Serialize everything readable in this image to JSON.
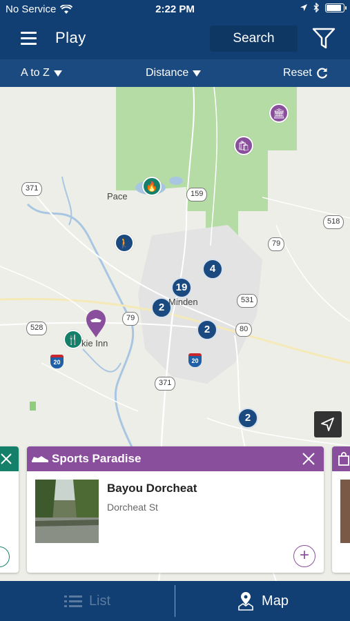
{
  "status_bar": {
    "carrier": "No Service",
    "time": "2:22 PM",
    "battery_level": 0.9
  },
  "header": {
    "title": "Play",
    "search_label": "Search",
    "menu_icon": "hamburger-icon",
    "filter_icon": "filter-icon"
  },
  "sort_bar": {
    "az_label": "A to Z",
    "distance_label": "Distance",
    "reset_label": "Reset"
  },
  "map": {
    "towns": [
      "Pace",
      "Minden",
      "kie Inn"
    ],
    "routes": [
      "371",
      "159",
      "518",
      "79",
      "531",
      "528",
      "79",
      "80",
      "371",
      "20",
      "20"
    ],
    "clusters": [
      "19",
      "4",
      "2",
      "2",
      "2"
    ],
    "colors": {
      "navy": "#1a4a80",
      "purple": "#8a4f9c",
      "green": "#15806a",
      "forest": "#b5dca5"
    }
  },
  "card": {
    "category": "Sports Paradise",
    "name": "Bayou Dorcheat",
    "address": "Dorcheat St",
    "add_symbol": "+"
  },
  "tabs": {
    "list_label": "List",
    "map_label": "Map"
  }
}
